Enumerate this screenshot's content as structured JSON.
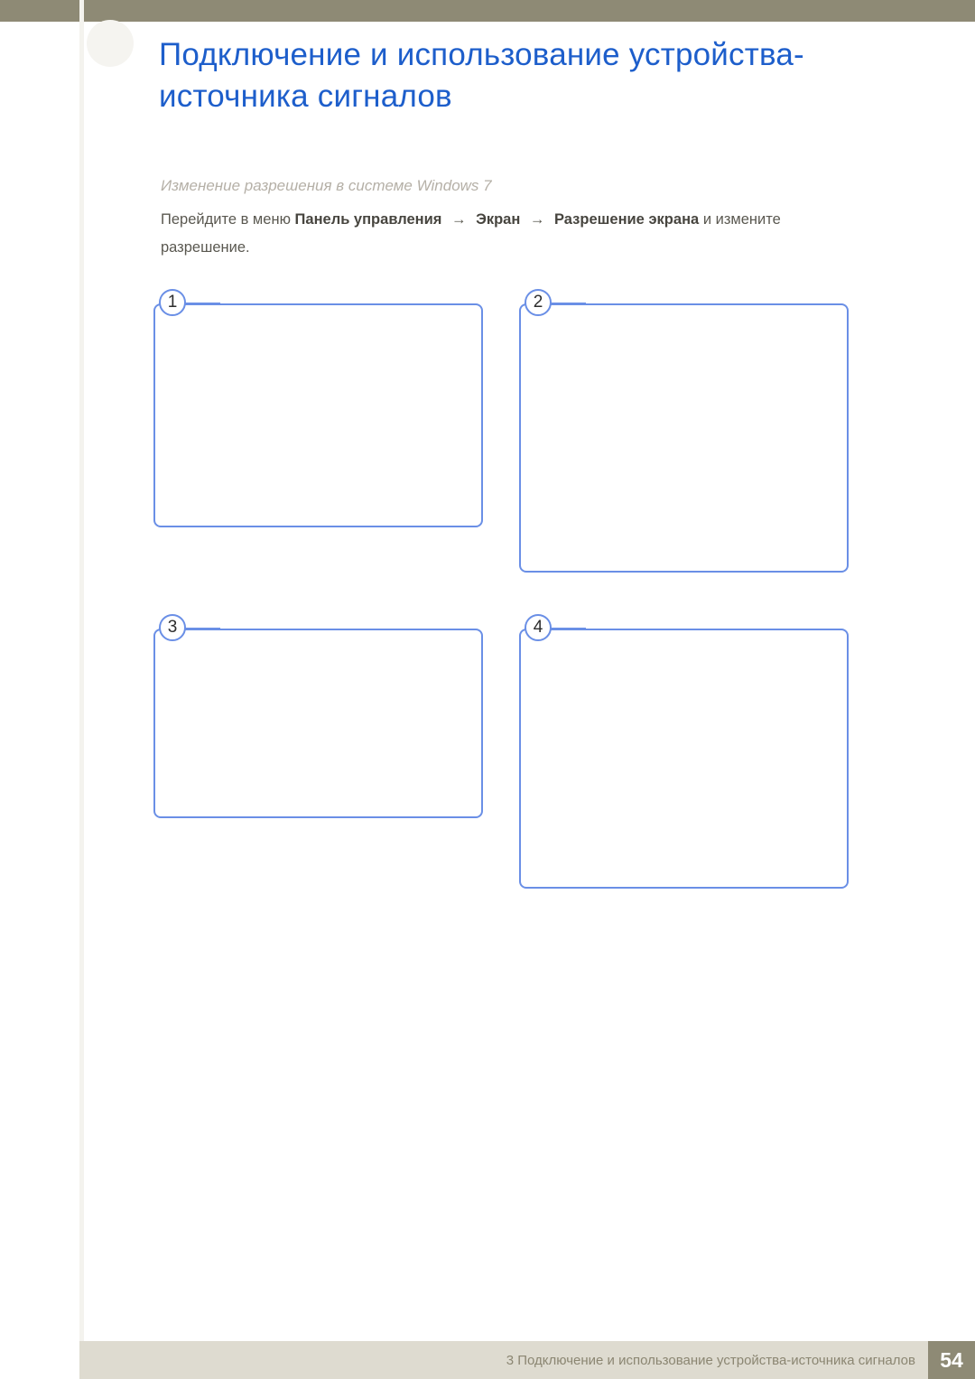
{
  "header": {
    "title": "Подключение и использование устройства-источника сигналов"
  },
  "section": {
    "subtitle": "Изменение разрешения в системе Windows 7",
    "instruction_prefix": "Перейдите в меню ",
    "path_part1": "Панель управления",
    "path_part2": "Экран",
    "path_part3": "Разрешение экрана",
    "instruction_suffix_1": " и измените",
    "instruction_suffix_2": "разрешение.",
    "arrow": "→"
  },
  "steps": [
    {
      "num": "1"
    },
    {
      "num": "2"
    },
    {
      "num": "3"
    },
    {
      "num": "4"
    }
  ],
  "footer": {
    "chapter_label": "3 Подключение и использование устройства-источника сигналов",
    "page_number": "54"
  }
}
